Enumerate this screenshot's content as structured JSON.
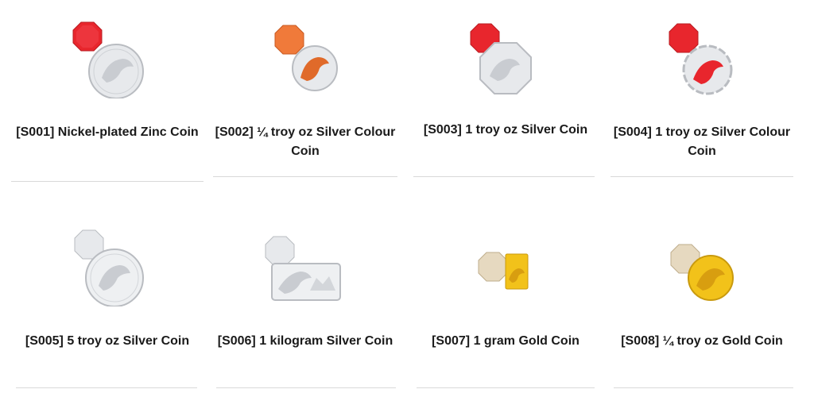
{
  "products": [
    {
      "code": "[S001]",
      "name": "Nickel-plated Zinc Coin",
      "label": "[S001] Nickel-plated Zinc Coin",
      "image": "red-octagon-and-silver-coin"
    },
    {
      "code": "[S002]",
      "name": "¼ troy oz Silver Colour Coin",
      "label": "[S002] ¼ troy oz Silver Colour Coin",
      "image": "orange-octagon-and-colour-coin"
    },
    {
      "code": "[S003]",
      "name": "1 troy oz Silver Coin",
      "label": "[S003] 1 troy oz Silver Coin",
      "image": "red-octagon-and-octagon-silver-coin"
    },
    {
      "code": "[S004]",
      "name": "1 troy oz Silver Colour Coin",
      "label": "[S004] 1 troy oz Silver Colour Coin",
      "image": "red-octagon-and-scalloped-colour-coin"
    },
    {
      "code": "[S005]",
      "name": "5 troy oz Silver Coin",
      "label": "[S005] 5 troy oz Silver Coin",
      "image": "silver-octagon-and-silver-coin"
    },
    {
      "code": "[S006]",
      "name": "1 kilogram Silver Coin",
      "label": "[S006] 1 kilogram Silver Coin",
      "image": "silver-octagon-and-rectangular-silver-coin"
    },
    {
      "code": "[S007]",
      "name": "1 gram Gold Coin",
      "label": "[S007] 1 gram Gold Coin",
      "image": "beige-octagon-and-gold-bar"
    },
    {
      "code": "[S008]",
      "name": "¼ troy oz Gold Coin",
      "label": "[S008] ¼ troy oz Gold Coin",
      "image": "beige-octagon-and-gold-coin"
    }
  ],
  "colors": {
    "red": "#e8262d",
    "orange": "#f07a3a",
    "silver": "#e7e9ec",
    "gold": "#f2c21a",
    "beige": "#e6d9c0",
    "text": "#1a1a1a",
    "divider": "#d9d9d9"
  }
}
